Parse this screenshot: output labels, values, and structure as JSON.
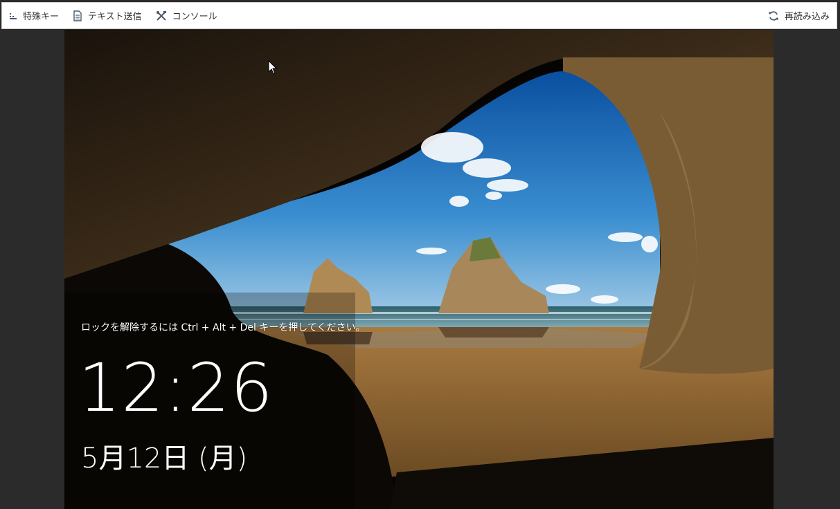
{
  "toolbar": {
    "special_keys": "特殊キー",
    "send_text": "テキスト送信",
    "console": "コンソール",
    "reload": "再読み込み"
  },
  "lockscreen": {
    "hint": "ロックを解除するには Ctrl + Alt + Del キーを押してください。",
    "time": "12:26",
    "date": "5月12日 (月)"
  },
  "icons": {
    "special_keys": "keyboard-bars-icon",
    "send_text": "document-icon",
    "console": "tools-icon",
    "reload": "refresh-icon"
  }
}
